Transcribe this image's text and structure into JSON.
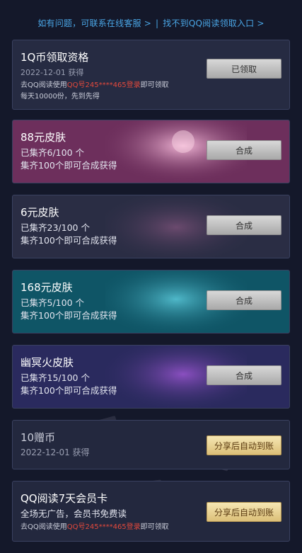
{
  "topbar": {
    "contact_link": "如有问题，可联系在线客服 >",
    "separator": "|",
    "entry_link": "找不到QQ阅读领取入口 >"
  },
  "cards": [
    {
      "title": "1Q币领取资格",
      "date": "2022-12-01 获得",
      "note_prefix": "去QQ阅读使用",
      "note_account": "QQ号245****465登录",
      "note_suffix": "即可领取",
      "note2": "每天10000份，先到先得",
      "button": "已领取",
      "bg": "#262b42"
    },
    {
      "title": "88元皮肤",
      "progress": "已集齐6/100 个",
      "hint": "集齐100个即可合成获得",
      "collected": 6,
      "total": 100,
      "button": "合成",
      "bg": "#6d2f5c"
    },
    {
      "title": "6元皮肤",
      "progress": "已集齐23/100 个",
      "hint": "集齐100个即可合成获得",
      "collected": 23,
      "total": 100,
      "button": "合成",
      "bg": "#2a2d44"
    },
    {
      "title": "168元皮肤",
      "progress": "已集齐5/100 个",
      "hint": "集齐100个即可合成获得",
      "collected": 5,
      "total": 100,
      "button": "合成",
      "bg": "#0f5566"
    },
    {
      "title": "幽冥火皮肤",
      "progress": "已集齐15/100 个",
      "hint": "集齐100个即可合成获得",
      "collected": 15,
      "total": 100,
      "button": "合成",
      "bg": "#2a2a5e"
    },
    {
      "title": "10赠币",
      "date": "2022-12-01 获得",
      "button": "分享后自动到账",
      "bg": "#23283e"
    },
    {
      "title": "QQ阅读7天会员卡",
      "line": "全场无广告，会员书免费读",
      "note_prefix": "去QQ阅读使用",
      "note_account": "QQ号245****465登录",
      "note_suffix": "即可领取",
      "button": "分享后自动到账",
      "bg": "#23283e"
    }
  ]
}
